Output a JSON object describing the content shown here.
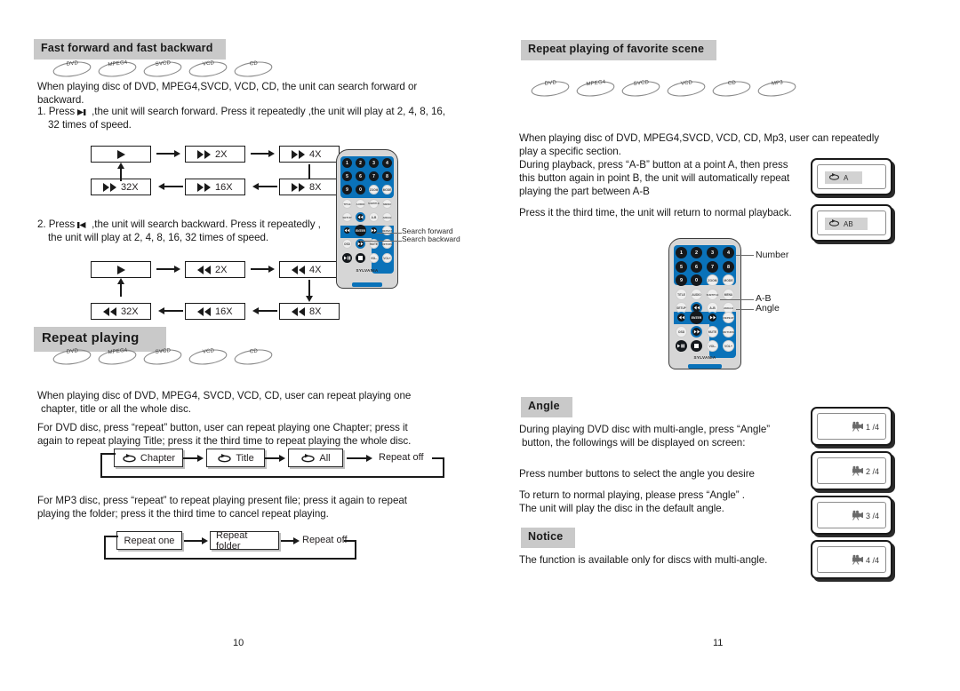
{
  "document": {
    "left_page_number": "10",
    "right_page_number": "11"
  },
  "left_column": {
    "section_fast": {
      "heading": "Fast forward and fast backward",
      "disc_badges": [
        "DVD",
        "MPEG4",
        "SVCD",
        "VCD",
        "CD"
      ],
      "intro": "When playing disc of DVD, MPEG4,SVCD, VCD, CD, the unit can search forward or backward.",
      "step1": "1. Press",
      "step1_cont": ",the unit will search forward. Press it repeatedly ,the unit will play at 2, 4, 8, 16,",
      "step1_line2": "32 times of speed.",
      "step2": "2. Press",
      "step2_cont": ",the unit will search backward. Press it repeatedly ,",
      "step2_line2": "the unit will play at 2, 4, 8, 16, 32 times of speed.",
      "forward_flow": {
        "play_label": "",
        "steps": [
          "2X",
          "4X",
          "8X",
          "16X",
          "32X"
        ]
      },
      "backward_flow": {
        "play_label": "",
        "steps": [
          "2X",
          "4X",
          "8X",
          "16X",
          "32X"
        ]
      }
    },
    "remote_callouts": {
      "search_forward": "Search forward",
      "search_backward": "Search backward"
    },
    "section_repeat": {
      "heading": "Repeat playing",
      "disc_badges": [
        "DVD",
        "MPEG4",
        "SVCD",
        "VCD",
        "CD"
      ],
      "para1_l1": "When playing disc of DVD, MPEG4, SVCD, VCD, CD,  user can repeat playing one",
      "para1_l2": "chapter, title or all the whole disc.",
      "para2_l1": "For DVD disc, press “repeat” button, user can repeat playing one Chapter; press it",
      "para2_l2": "again to repeat playing Title; press it the third time to repeat playing the whole disc.",
      "dvd_cycle": [
        "Chapter",
        "Title",
        "All"
      ],
      "dvd_cycle_end": "Repeat off",
      "para3_l1": "For MP3 disc, press “repeat” to repeat playing present file; press it again to repeat",
      "para3_l2": "playing the folder; press it the third time to cancel repeat playing.",
      "mp3_cycle": [
        "Repeat one",
        "Repeat folder"
      ],
      "mp3_cycle_end": "Repeat off"
    }
  },
  "right_column": {
    "section_favorite": {
      "heading": "Repeat playing of favorite scene",
      "disc_badges": [
        "DVD",
        "MPEG4",
        "SVCD",
        "VCD",
        "CD",
        "MP3"
      ],
      "para1_l1": "When playing disc of DVD, MPEG4,SVCD, VCD, CD, Mp3,  user can repeatedly",
      "para1_l2": "play a specific section.",
      "para2_l1": "During playback, press “A-B” button at a point A, then press",
      "para2_l2": "this button again in  point B, the unit will automatically repeat",
      "para2_l3": "playing the part between A-B",
      "para3": "Press it the third time, the unit will return to normal playback.",
      "osd_a": "A",
      "osd_ab": "AB"
    },
    "remote_callouts": {
      "number": "Number",
      "ab": "A-B",
      "angle": "Angle"
    },
    "section_angle": {
      "heading": "Angle",
      "para1_l1": "During playing DVD disc with multi-angle, press “Angle”",
      "para1_l2": "button, the followings will be displayed on screen:",
      "para2": "Press number buttons to select the angle you desire",
      "para3_l1": "To return to normal playing, please press “Angle” .",
      "para3_l2": "The unit will play the disc in the default angle.",
      "osd_angles": [
        "1 /4",
        "2 /4",
        "3 /4",
        "4 /4"
      ]
    },
    "section_notice": {
      "heading": "Notice",
      "text": "The function is available only for discs with multi-angle."
    }
  },
  "remote_keys": {
    "numbers": [
      "1",
      "2",
      "3",
      "4",
      "5",
      "6",
      "7",
      "8",
      "9",
      "0"
    ],
    "row3_right": [
      "ZOOM",
      "MODE"
    ],
    "row4": [
      "TITLE",
      "AUDIO",
      "SUBTITLE",
      "MENU"
    ],
    "row5": [
      "SETUP",
      "PREV",
      "A-B",
      "ANGLE"
    ],
    "row6": [
      "REW",
      "ENTER",
      "FWD",
      "REPEAT"
    ],
    "row7": [
      "OSD",
      "NEXT",
      "MUTE",
      "RETURN"
    ],
    "row8": [
      "PLAY",
      "STOP",
      "VOL-",
      "VOL+"
    ],
    "brand": "SYLVANIA"
  },
  "colors": {
    "heading_bar": "#c9c9c9",
    "remote_panel_blue": "#0a72b9",
    "remote_body": "#d6d6d6",
    "key_dark": "#14181c",
    "text": "#1a1a1a"
  }
}
